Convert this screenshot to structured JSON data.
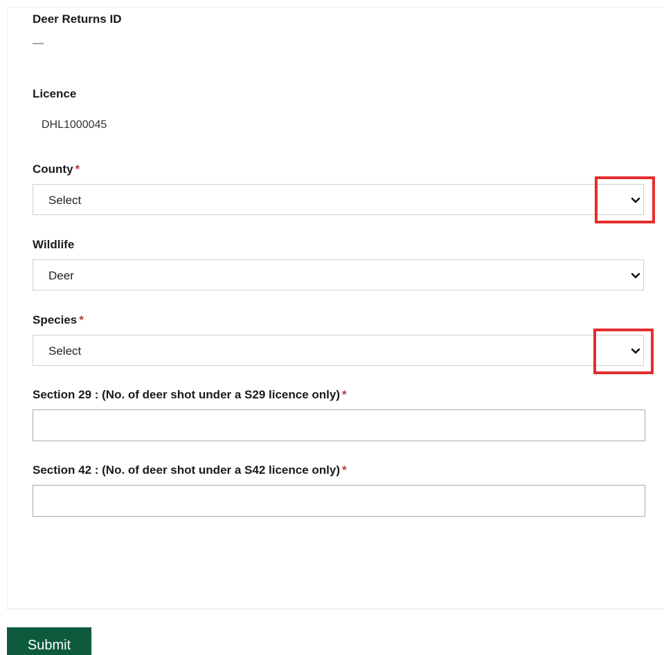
{
  "form": {
    "deer_returns_id": {
      "label": "Deer Returns ID",
      "value": "—"
    },
    "licence": {
      "label": "Licence",
      "value": "DHL1000045"
    },
    "county": {
      "label": "County",
      "required_mark": "*",
      "selected": "Select"
    },
    "wildlife": {
      "label": "Wildlife",
      "selected": "Deer"
    },
    "species": {
      "label": "Species",
      "required_mark": "*",
      "selected": "Select"
    },
    "section29": {
      "label": "Section 29 : (No. of deer shot under a S29 licence only)",
      "required_mark": "*",
      "value": ""
    },
    "section42": {
      "label": "Section 42 : (No. of deer shot under a S42 licence only)",
      "required_mark": "*",
      "value": ""
    },
    "submit_label": "Submit"
  },
  "icons": {
    "dropdown": "chevron-down-icon"
  },
  "colors": {
    "highlight": "#e52d2d",
    "submit_bg": "#0d5a3d",
    "required": "#b04040"
  }
}
